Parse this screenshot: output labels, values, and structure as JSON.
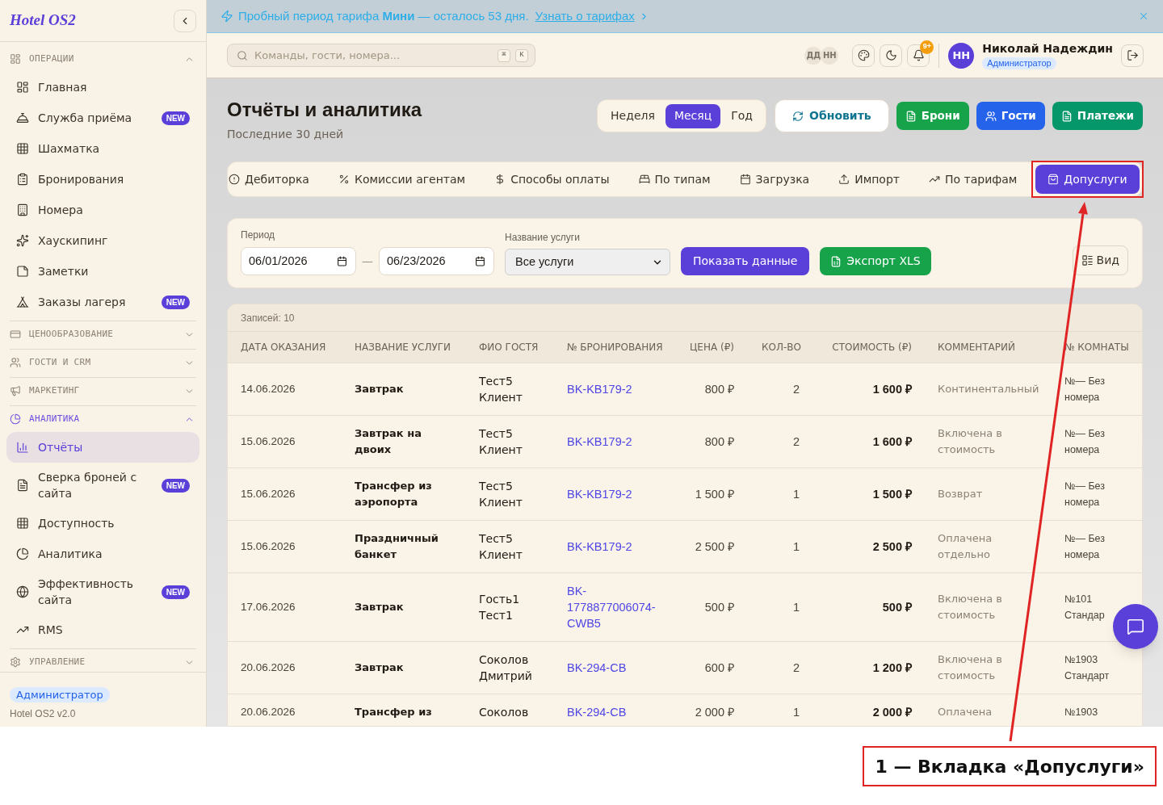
{
  "sidebar": {
    "logo": "Hotel OS2",
    "sections": [
      {
        "title": "ОПЕРАЦИИ",
        "expanded": true,
        "items": [
          {
            "label": "Главная",
            "selected": false
          },
          {
            "label": "Служба приёма",
            "selected": false,
            "badge": "NEW"
          },
          {
            "label": "Шахматка",
            "selected": false
          },
          {
            "label": "Бронирования",
            "selected": false
          },
          {
            "label": "Номера",
            "selected": false
          },
          {
            "label": "Хаускипинг",
            "selected": false
          },
          {
            "label": "Заметки",
            "selected": false
          },
          {
            "label": "Заказы лагеря",
            "selected": false,
            "badge": "NEW"
          }
        ]
      },
      {
        "title": "ЦЕНООБРАЗОВАНИЕ",
        "expanded": false
      },
      {
        "title": "ГОСТИ И CRM",
        "expanded": false
      },
      {
        "title": "МАРКЕТИНГ",
        "expanded": false
      },
      {
        "title": "АНАЛИТИКА",
        "expanded": true,
        "items": [
          {
            "label": "Отчёты",
            "selected": true
          },
          {
            "label": "Сверка броней с сайта",
            "selected": false,
            "badge": "NEW"
          },
          {
            "label": "Доступность",
            "selected": false
          },
          {
            "label": "Аналитика",
            "selected": false
          },
          {
            "label": "Эффективность сайта",
            "selected": false,
            "badge": "NEW"
          },
          {
            "label": "RMS",
            "selected": false
          }
        ]
      },
      {
        "title": "УПРАВЛЕНИЕ",
        "expanded": false
      }
    ],
    "footer": {
      "role": "Администратор",
      "version": "Hotel OS2 v2.0"
    }
  },
  "banner": {
    "text": "Пробный период тарифа **Мини** — осталось 53 дня.",
    "link": "Узнать о тарифах"
  },
  "topbar": {
    "search": {
      "placeholder": "Команды, гости, номера...",
      "keys": [
        "⌘",
        "K"
      ]
    },
    "presence": [
      "ДД",
      "НН"
    ],
    "notifications": "9+",
    "user": {
      "initials": "НН",
      "name": "Николай Надеждин",
      "role": "Администратор"
    }
  },
  "page": {
    "title": "Отчёты и аналитика",
    "subtitle": "Последние 30 дней",
    "periods": [
      {
        "label": "Неделя",
        "selected": false
      },
      {
        "label": "Месяц",
        "selected": true
      },
      {
        "label": "Год",
        "selected": false
      }
    ],
    "actions": [
      {
        "label": "Обновить",
        "kind": "outline"
      },
      {
        "label": "Брони",
        "kind": "filled",
        "color": "#16a34a"
      },
      {
        "label": "Гости",
        "kind": "filled",
        "color": "#2563eb"
      },
      {
        "label": "Платежи",
        "kind": "filled",
        "color": "#059669"
      }
    ]
  },
  "report_tabs": [
    {
      "label": "Дебиторка",
      "selected": false,
      "highlighted": false
    },
    {
      "label": "Комиссии агентам",
      "selected": false,
      "highlighted": false
    },
    {
      "label": "Способы оплаты",
      "selected": false,
      "highlighted": false
    },
    {
      "label": "По типам",
      "selected": false,
      "highlighted": false
    },
    {
      "label": "Загрузка",
      "selected": false,
      "highlighted": false
    },
    {
      "label": "Импорт",
      "selected": false,
      "highlighted": false
    },
    {
      "label": "По тарифам",
      "selected": false,
      "highlighted": false
    },
    {
      "label": "Допуслуги",
      "selected": true,
      "highlighted": true
    }
  ],
  "filters": {
    "period_label": "Период",
    "date_from": "06/01/2026",
    "separator": "—",
    "date_to": "06/23/2026",
    "service_label": "Название услуги",
    "service_value": "Все услуги",
    "apply": "Показать данные",
    "export": "Экспорт XLS",
    "view": "Вид"
  },
  "table": {
    "count": "Записей: 10",
    "columns": [
      "ДАТА ОКАЗАНИЯ",
      "НАЗВАНИЕ УСЛУГИ",
      "ФИО ГОСТЯ",
      "№ БРОНИРОВАНИЯ",
      "ЦЕНА (₽)",
      "КОЛ-ВО",
      "СТОИМОСТЬ (₽)",
      "КОММЕНТАРИЙ",
      "№ КОМНАТЫ"
    ],
    "rows": [
      {
        "date": "14.06.2026",
        "service": "Завтрак",
        "guest": "Тест5 Клиент",
        "booking": "BK-KB179-2",
        "price": "800 ₽",
        "qty": "2",
        "total": "1 600 ₽",
        "comment": "Континентальный",
        "room": "№— Без номера"
      },
      {
        "date": "15.06.2026",
        "service": "Завтрак на двоих",
        "guest": "Тест5 Клиент",
        "booking": "BK-KB179-2",
        "price": "800 ₽",
        "qty": "2",
        "total": "1 600 ₽",
        "comment": "Включена в стоимость",
        "room": "№— Без номера"
      },
      {
        "date": "15.06.2026",
        "service": "Трансфер из аэропорта",
        "guest": "Тест5 Клиент",
        "booking": "BK-KB179-2",
        "price": "1 500 ₽",
        "qty": "1",
        "total": "1 500 ₽",
        "comment": "Возврат",
        "room": "№— Без номера"
      },
      {
        "date": "15.06.2026",
        "service": "Праздничный банкет",
        "guest": "Тест5 Клиент",
        "booking": "BK-KB179-2",
        "price": "2 500 ₽",
        "qty": "1",
        "total": "2 500 ₽",
        "comment": "Оплачена отдельно",
        "room": "№— Без номера"
      },
      {
        "date": "17.06.2026",
        "service": "Завтрак",
        "guest": "Гость1 Тест1",
        "booking": "BK-1778877006074-CWB5",
        "price": "500 ₽",
        "qty": "1",
        "total": "500 ₽",
        "comment": "Включена в стоимость",
        "room": "№101 Стандар"
      },
      {
        "date": "20.06.2026",
        "service": "Завтрак",
        "guest": "Соколов Дмитрий",
        "booking": "BK-294-CB",
        "price": "600 ₽",
        "qty": "2",
        "total": "1 200 ₽",
        "comment": "Включена в стоимость",
        "room": "№1903 Стандарт"
      },
      {
        "date": "20.06.2026",
        "service": "Трансфер из",
        "guest": "Соколов",
        "booking": "BK-294-CB",
        "price": "2 000 ₽",
        "qty": "1",
        "total": "2 000 ₽",
        "comment": "Оплачена",
        "room": "№1903"
      }
    ]
  },
  "annotation": {
    "text": "1 — Вкладка «Допуслуги»"
  }
}
